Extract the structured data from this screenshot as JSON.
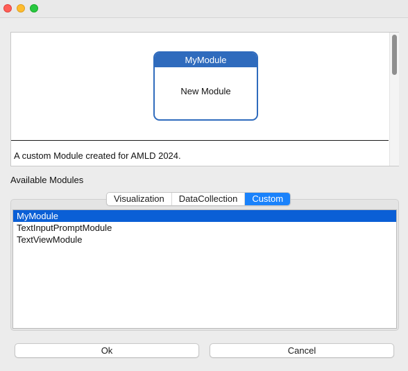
{
  "window": {
    "controls": [
      "close",
      "minimize",
      "maximize"
    ]
  },
  "preview": {
    "module_card": {
      "title": "MyModule",
      "body": "New Module"
    },
    "description": "A custom Module created for AMLD 2024."
  },
  "available_modules": {
    "label": "Available Modules",
    "tabs": [
      {
        "label": "Visualization",
        "active": false
      },
      {
        "label": "DataCollection",
        "active": false
      },
      {
        "label": "Custom",
        "active": true
      }
    ],
    "items": [
      {
        "label": "MyModule",
        "selected": true
      },
      {
        "label": "TextInputPromptModule",
        "selected": false
      },
      {
        "label": "TextViewModule",
        "selected": false
      }
    ]
  },
  "buttons": {
    "ok_label": "Ok",
    "cancel_label": "Cancel"
  },
  "colors": {
    "accent": "#1a82fb",
    "selection": "#0a5fd6",
    "module_border": "#2f6bbd"
  }
}
